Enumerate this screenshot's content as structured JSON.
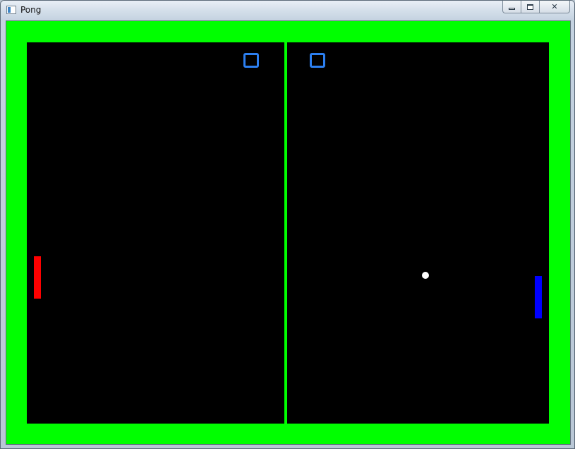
{
  "window": {
    "title": "Pong",
    "controls": {
      "minimize_icon": "minimize-icon",
      "maximize_icon": "maximize-icon",
      "close_label": "✕"
    }
  },
  "game": {
    "colors": {
      "border": "#00ff00",
      "court": "#000000",
      "net": "#00ff00",
      "score": "#2c7ff0",
      "left_paddle": "#ff0000",
      "right_paddle": "#0000ff",
      "ball": "#ffffff"
    },
    "scores": {
      "left": "",
      "right": ""
    }
  }
}
